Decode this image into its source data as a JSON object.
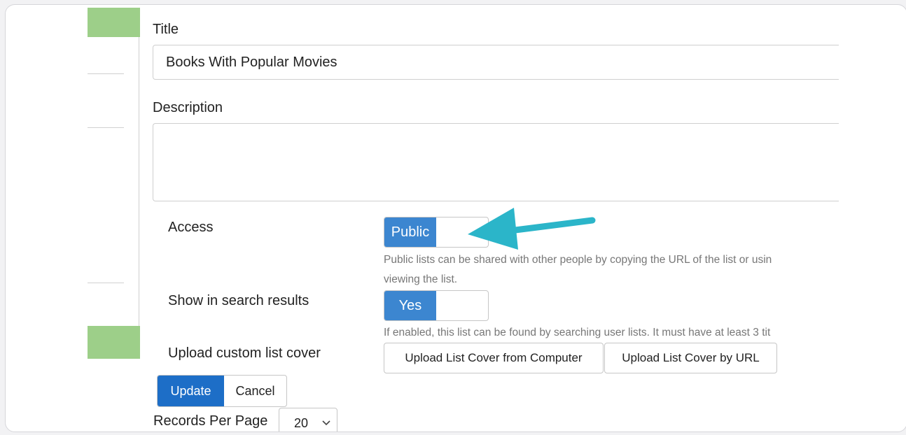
{
  "form": {
    "title_label": "Title",
    "title_value": "Books With Popular Movies",
    "description_label": "Description",
    "description_value": "",
    "access": {
      "label": "Access",
      "toggle_value": "Public",
      "help": "Public lists can be shared with other people by copying the URL of the list or usin",
      "help2": "viewing the list."
    },
    "search": {
      "label": "Show in search results",
      "toggle_value": "Yes",
      "help": "If enabled, this list can be found by searching user lists. It must have at least 3 tit"
    },
    "cover": {
      "label": "Upload custom list cover",
      "from_computer": "Upload List Cover from Computer",
      "by_url": "Upload List Cover by URL"
    },
    "update_label": "Update",
    "cancel_label": "Cancel",
    "records_per_page": {
      "label": "Records Per Page",
      "value": "20"
    }
  },
  "colors": {
    "toggle_on": "#3c86d0",
    "update_button": "#1d6ec7",
    "sidebar_accent": "#9dcf89",
    "annotation_arrow": "#2bb5c9"
  }
}
